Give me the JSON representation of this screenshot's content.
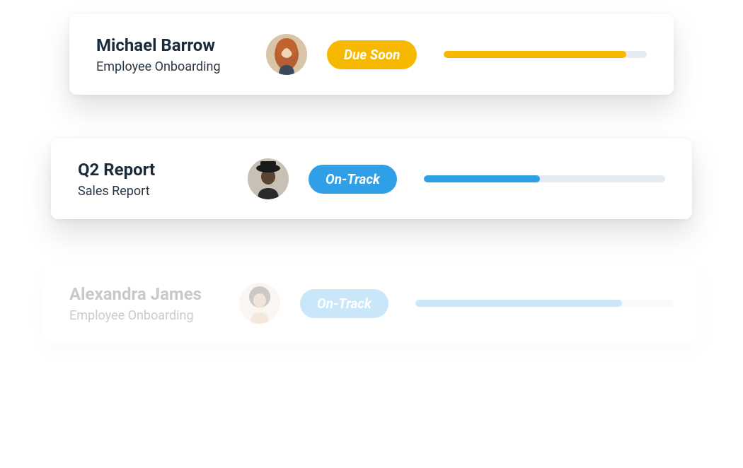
{
  "items": [
    {
      "title": "Michael Barrow",
      "subtitle": "Employee Onboarding",
      "status_label": "Due Soon",
      "status_kind": "due-soon",
      "progress_percent": 90,
      "progress_color": "yellow"
    },
    {
      "title": "Q2 Report",
      "subtitle": "Sales Report",
      "status_label": "On-Track",
      "status_kind": "on-track",
      "progress_percent": 48,
      "progress_color": "blue"
    },
    {
      "title": "Alexandra James",
      "subtitle": "Employee Onboarding",
      "status_label": "On-Track",
      "status_kind": "on-track",
      "progress_percent": 80,
      "progress_color": "blue"
    }
  ],
  "colors": {
    "due_soon": "#f6b800",
    "on_track": "#2f9fe8",
    "progress_bg": "#e6ebef",
    "text_primary": "#1a2b3c",
    "text_secondary": "#2a3642"
  }
}
